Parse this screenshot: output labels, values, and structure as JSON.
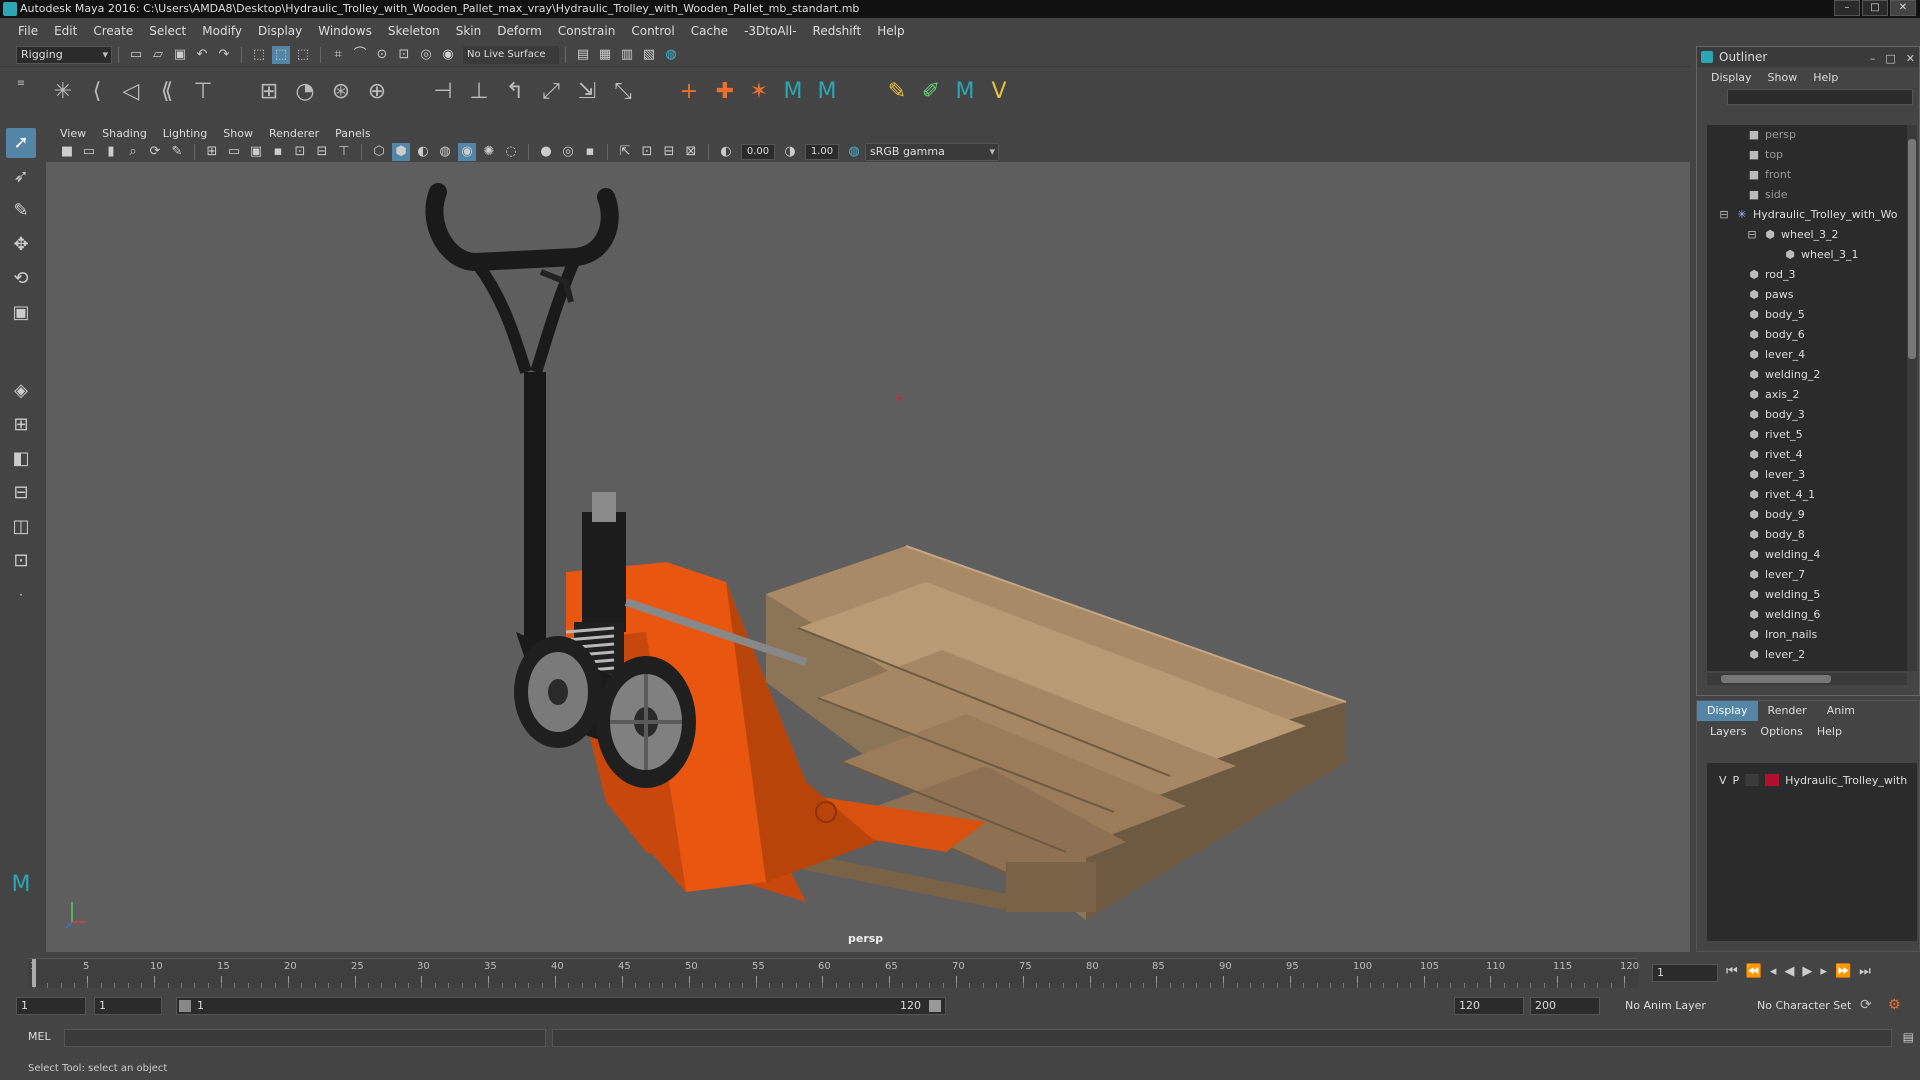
{
  "window": {
    "title": "Autodesk Maya 2016: C:\\Users\\AMDA8\\Desktop\\Hydraulic_Trolley_with_Wooden_Pallet_max_vray\\Hydraulic_Trolley_with_Wooden_Pallet_mb_standart.mb"
  },
  "menu": [
    "File",
    "Edit",
    "Create",
    "Select",
    "Modify",
    "Display",
    "Windows",
    "Skeleton",
    "Skin",
    "Deform",
    "Constrain",
    "Control",
    "Cache",
    "-3DtoAll-",
    "Redshift",
    "Help"
  ],
  "shelf": {
    "menu_set": "Rigging",
    "live_surface": "No Live Surface"
  },
  "panel_menu": [
    "View",
    "Shading",
    "Lighting",
    "Show",
    "Renderer",
    "Panels"
  ],
  "panel_toolbar": {
    "exposure": "0.00",
    "gamma": "1.00",
    "color_space": "sRGB gamma"
  },
  "viewport": {
    "camera_label": "persp",
    "background": "#5e5e5e",
    "trolley_color": "#e8560f",
    "wood_color": "#a88a66"
  },
  "outliner": {
    "title": "Outliner",
    "menu": [
      "Display",
      "Show",
      "Help"
    ],
    "items": [
      {
        "name": "persp",
        "kind": "camera"
      },
      {
        "name": "top",
        "kind": "camera"
      },
      {
        "name": "front",
        "kind": "camera"
      },
      {
        "name": "side",
        "kind": "camera"
      },
      {
        "name": "Hydraulic_Trolley_with_Wo",
        "kind": "group"
      },
      {
        "name": "wheel_3_2",
        "kind": "mesh"
      },
      {
        "name": "wheel_3_1",
        "kind": "mesh"
      },
      {
        "name": "rod_3",
        "kind": "mesh"
      },
      {
        "name": "paws",
        "kind": "mesh"
      },
      {
        "name": "body_5",
        "kind": "mesh"
      },
      {
        "name": "body_6",
        "kind": "mesh"
      },
      {
        "name": "lever_4",
        "kind": "mesh"
      },
      {
        "name": "welding_2",
        "kind": "mesh"
      },
      {
        "name": "axis_2",
        "kind": "mesh"
      },
      {
        "name": "body_3",
        "kind": "mesh"
      },
      {
        "name": "rivet_5",
        "kind": "mesh"
      },
      {
        "name": "rivet_4",
        "kind": "mesh"
      },
      {
        "name": "lever_3",
        "kind": "mesh"
      },
      {
        "name": "rivet_4_1",
        "kind": "mesh"
      },
      {
        "name": "body_9",
        "kind": "mesh"
      },
      {
        "name": "body_8",
        "kind": "mesh"
      },
      {
        "name": "welding_4",
        "kind": "mesh"
      },
      {
        "name": "lever_7",
        "kind": "mesh"
      },
      {
        "name": "welding_5",
        "kind": "mesh"
      },
      {
        "name": "welding_6",
        "kind": "mesh"
      },
      {
        "name": "Iron_nails",
        "kind": "mesh"
      },
      {
        "name": "lever_2",
        "kind": "mesh"
      }
    ]
  },
  "layers": {
    "tabs": [
      "Display",
      "Render",
      "Anim"
    ],
    "menu": [
      "Layers",
      "Options",
      "Help"
    ],
    "row": {
      "v": "V",
      "p": "P",
      "name": "Hydraulic_Trolley_with"
    }
  },
  "timeline": {
    "ticks": [
      "1",
      "5",
      "10",
      "15",
      "20",
      "25",
      "30",
      "35",
      "40",
      "45",
      "50",
      "55",
      "60",
      "65",
      "70",
      "75",
      "80",
      "85",
      "90",
      "95",
      "100",
      "105",
      "110",
      "115",
      "120"
    ],
    "current_frame": "1"
  },
  "range": {
    "start": "1",
    "anim_start": "1",
    "slider_start": "1",
    "slider_end": "120",
    "end": "120",
    "anim_end": "200",
    "anim_layer": "No Anim Layer",
    "character_set": "No Character Set"
  },
  "command": {
    "label": "MEL"
  },
  "help_line": "Select Tool: select an object"
}
